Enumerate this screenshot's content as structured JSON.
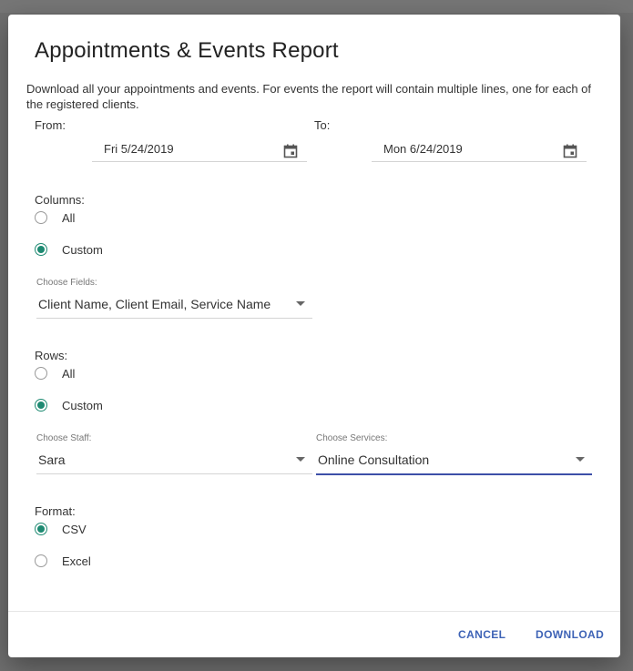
{
  "dialog": {
    "title": "Appointments & Events Report",
    "description": "Download all your appointments and events. For events the report will contain multiple lines, one for each of the registered clients."
  },
  "dates": {
    "from_label": "From:",
    "from_value": "Fri 5/24/2019",
    "to_label": "To:",
    "to_value": "Mon 6/24/2019"
  },
  "columns": {
    "label": "Columns:",
    "options": [
      "All",
      "Custom"
    ],
    "selected": "Custom",
    "fields_label": "Choose Fields:",
    "fields_value": "Client Name, Client Email, Service Name"
  },
  "rows": {
    "label": "Rows:",
    "options": [
      "All",
      "Custom"
    ],
    "selected": "Custom",
    "staff_label": "Choose Staff:",
    "staff_value": "Sara",
    "services_label": "Choose Services:",
    "services_value": "Online Consultation"
  },
  "format": {
    "label": "Format:",
    "options": [
      "CSV",
      "Excel"
    ],
    "selected": "CSV"
  },
  "actions": {
    "cancel": "CANCEL",
    "download": "DOWNLOAD"
  },
  "colors": {
    "accent_radio": "#1e8a72",
    "button_text": "#3e63b6",
    "active_underline": "#3d4fa8"
  }
}
